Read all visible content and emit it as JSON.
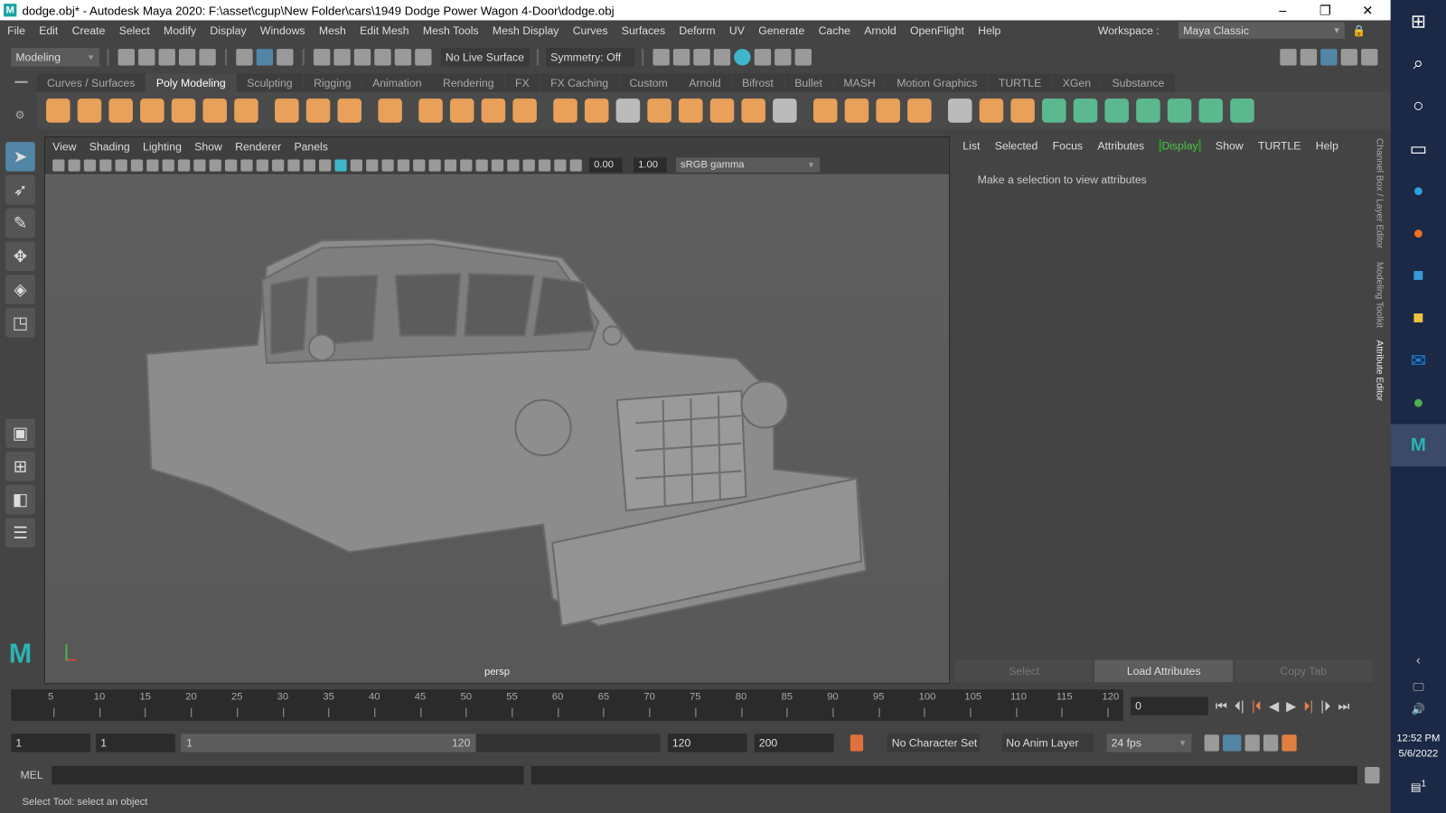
{
  "title_bar": {
    "title": "dodge.obj* - Autodesk Maya 2020: F:\\asset\\cgup\\New Folder\\cars\\1949 Dodge Power Wagon 4-Door\\dodge.obj",
    "minimize": "–",
    "maximize": "❐",
    "close": "✕"
  },
  "menu": [
    "File",
    "Edit",
    "Create",
    "Select",
    "Modify",
    "Display",
    "Windows",
    "Mesh",
    "Edit Mesh",
    "Mesh Tools",
    "Mesh Display",
    "Curves",
    "Surfaces",
    "Deform",
    "UV",
    "Generate",
    "Cache",
    "Arnold",
    "OpenFlight",
    "Help"
  ],
  "workspace": {
    "label": "Workspace :",
    "value": "Maya Classic"
  },
  "status_line": {
    "menu_set": "Modeling",
    "live_surface": "No Live Surface",
    "symmetry": "Symmetry: Off"
  },
  "shelf_tabs": [
    "Curves / Surfaces",
    "Poly Modeling",
    "Sculpting",
    "Rigging",
    "Animation",
    "Rendering",
    "FX",
    "FX Caching",
    "Custom",
    "Arnold",
    "Bifrost",
    "Bullet",
    "MASH",
    "Motion Graphics",
    "TURTLE",
    "XGen",
    "Substance"
  ],
  "active_shelf_tab": "Poly Modeling",
  "shelf_icons": [
    "sphere",
    "cube",
    "cylinder",
    "cone",
    "torus",
    "plane",
    "disc",
    "platonic",
    "super-shape",
    "type",
    "svg",
    "sculpt",
    "sew-uv",
    "combine",
    "separate",
    "extract",
    "smooth",
    "boolean",
    "mirror",
    "extrude",
    "bridge",
    "bevel",
    "fill-hole",
    "bridge-edge",
    "target-weld",
    "wedge",
    "cut",
    "multi-cut",
    "poly-append",
    "planar-uv",
    "automatic-uv",
    "cylindrical-uv",
    "spherical-uv",
    "unfold",
    "layout",
    "uv-editor",
    "symmetrize"
  ],
  "shelf_colors": {
    "orange": "#e8a05a",
    "green": "#5bb88f",
    "gray": "#bbbbbb"
  },
  "panel_menu": [
    "View",
    "Shading",
    "Lighting",
    "Show",
    "Renderer",
    "Panels"
  ],
  "panel_toolbar": {
    "exposure": "0.00",
    "gamma": "1.00",
    "color_space": "sRGB gamma"
  },
  "viewport": {
    "camera": "persp"
  },
  "attribute_editor": {
    "menu": [
      "List",
      "Selected",
      "Focus",
      "Attributes",
      "Display",
      "Show",
      "TURTLE",
      "Help"
    ],
    "highlighted": "Display",
    "message": "Make a selection to view attributes",
    "buttons": [
      "Select",
      "Load Attributes",
      "Copy Tab"
    ]
  },
  "side_tabs": [
    "Channel Box / Layer Editor",
    "Modeling Toolkit",
    "Attribute Editor"
  ],
  "time_slider": {
    "ticks": [
      "5",
      "10",
      "15",
      "20",
      "25",
      "30",
      "35",
      "40",
      "45",
      "50",
      "55",
      "60",
      "65",
      "70",
      "75",
      "80",
      "85",
      "90",
      "95",
      "100",
      "105",
      "110",
      "115",
      "120"
    ],
    "current_frame": "0"
  },
  "range_slider": {
    "start": "1",
    "playback_start": "1",
    "range_start": "1",
    "range_end": "120",
    "playback_end": "120",
    "end": "200",
    "character_set": "No Character Set",
    "anim_layer": "No Anim Layer",
    "fps": "24 fps"
  },
  "command_line": {
    "label": "MEL"
  },
  "help_line": "Select Tool: select an object",
  "taskbar": {
    "time": "12:52 PM",
    "date": "5/6/2022",
    "notifications": "1"
  }
}
